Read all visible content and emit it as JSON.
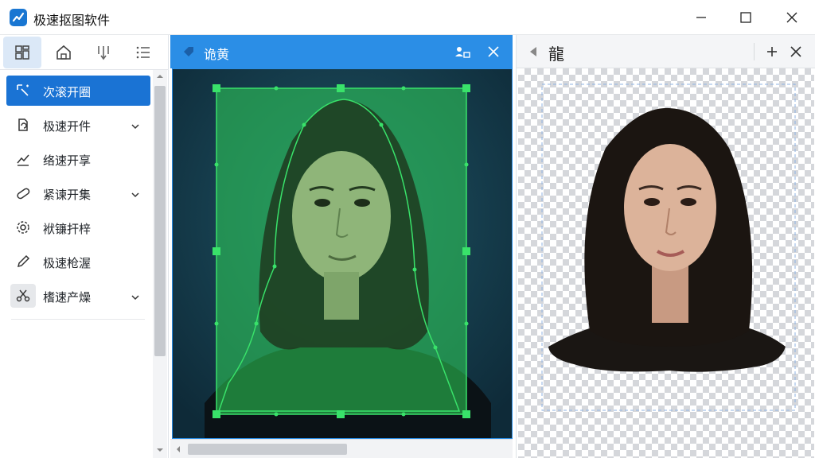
{
  "window": {
    "title": "极速抠图软件"
  },
  "sidebar": {
    "toolbar": [
      {
        "name": "grid-view",
        "active": true
      },
      {
        "name": "home",
        "active": false
      },
      {
        "name": "filter",
        "active": false
      },
      {
        "name": "list",
        "active": false
      }
    ],
    "items": [
      {
        "label": "次滚开圈",
        "icon": "magic-select-icon",
        "active": true,
        "expandable": false
      },
      {
        "label": "极速开件",
        "icon": "refresh-doc-icon",
        "active": false,
        "expandable": true
      },
      {
        "label": "络速开享",
        "icon": "trend-icon",
        "active": false,
        "expandable": false
      },
      {
        "label": "紧谏开集",
        "icon": "pill-icon",
        "active": false,
        "expandable": true
      },
      {
        "label": "袱镰扞梓",
        "icon": "gear-icon",
        "active": false,
        "expandable": false
      },
      {
        "label": "极速枪渥",
        "icon": "pen-icon",
        "active": false,
        "expandable": false
      },
      {
        "label": "榰速产燥",
        "icon": "scissors-icon",
        "active": false,
        "expandable": true
      }
    ]
  },
  "editor": {
    "tab_label": "诡黄"
  },
  "preview": {
    "tab_label": "龍"
  },
  "colors": {
    "accent": "#1a73d4",
    "header_blue": "#2b8ee6",
    "mask_green": "#2fd35a",
    "canvas_bg": "#163a4a"
  }
}
